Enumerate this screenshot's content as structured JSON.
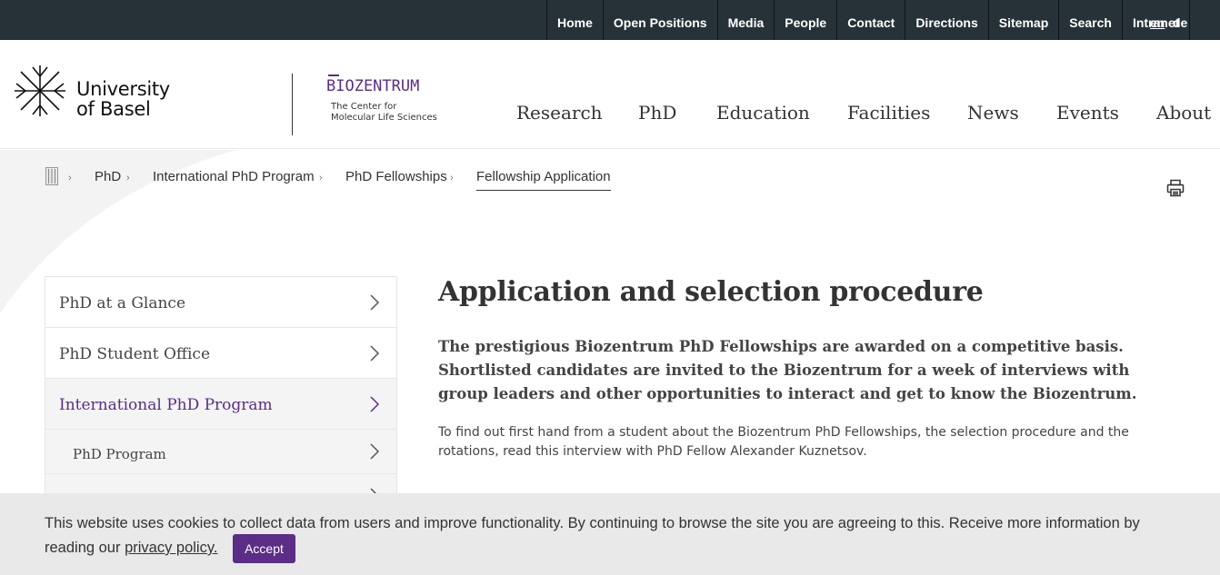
{
  "topnav": {
    "items": [
      "Home",
      "Open Positions",
      "Media",
      "People",
      "Contact",
      "Directions",
      "Sitemap",
      "Search",
      "Intranet"
    ],
    "lang_en": "en",
    "lang_de": "de"
  },
  "header": {
    "university_line1": "University",
    "university_line2": "of Basel",
    "biozentrum": "BIOZENTRUM",
    "biozentrum_sub1": "The Center for",
    "biozentrum_sub2": "Molecular Life Sciences"
  },
  "mainnav": [
    "Research",
    "PhD",
    "Education",
    "Facilities",
    "News",
    "Events",
    "About"
  ],
  "breadcrumb": [
    "PhD",
    "International PhD Program",
    "PhD Fellowships",
    "Fellowship Application"
  ],
  "sidenav": [
    {
      "label": "PhD at a Glance"
    },
    {
      "label": "PhD Student Office"
    },
    {
      "label": "International PhD Program"
    },
    {
      "label": "PhD Program"
    }
  ],
  "content": {
    "title": "Application and selection procedure",
    "lead": "The prestigious Biozentrum PhD Fellowships are awarded on a competitive basis. Shortlisted candidates are invited to the Biozentrum for a week of interviews with group leaders and other opportunities to interact and get to know the Biozentrum.",
    "body": "To find out first hand from a student about the Biozentrum PhD Fellowships, the selection procedure and the rotations, read this interview with PhD Fellow Alexander Kuznetsov."
  },
  "cookie": {
    "text": "This website uses cookies to collect data from users and improve functionality. By continuing to browse the site you are agreeing to this. Receive more information by reading our ",
    "link": "privacy policy.",
    "accept": "Accept"
  },
  "colors": {
    "topbar": "#263238",
    "accent": "#5b2d86",
    "cookie_bg": "#e9e9e9"
  }
}
